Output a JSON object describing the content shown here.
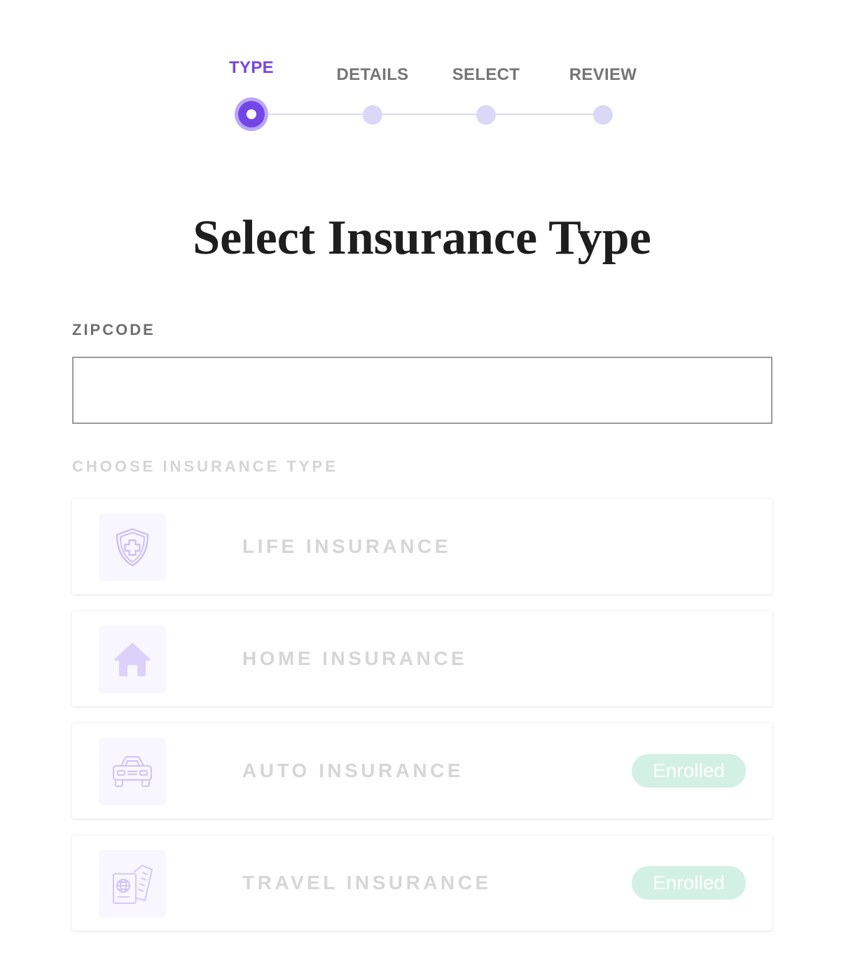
{
  "stepper": {
    "steps": [
      {
        "label": "TYPE",
        "active": true
      },
      {
        "label": "DETAILS",
        "active": false
      },
      {
        "label": "SELECT",
        "active": false
      },
      {
        "label": "REVIEW",
        "active": false
      }
    ],
    "accent_color": "#7346e8",
    "inactive_color": "#d9d8f6"
  },
  "main": {
    "title": "Select Insurance Type",
    "zipcode": {
      "label": "ZIPCODE",
      "value": "",
      "placeholder": ""
    },
    "choose_label": "CHOOSE INSURANCE TYPE",
    "options": [
      {
        "label": "LIFE INSURANCE",
        "icon": "shield-plus-icon",
        "badge": ""
      },
      {
        "label": "HOME INSURANCE",
        "icon": "home-icon",
        "badge": ""
      },
      {
        "label": "AUTO INSURANCE",
        "icon": "car-icon",
        "badge": "Enrolled"
      },
      {
        "label": "TRAVEL INSURANCE",
        "icon": "passport-icon",
        "badge": "Enrolled"
      }
    ],
    "badge_color": "#d3f0e4"
  }
}
